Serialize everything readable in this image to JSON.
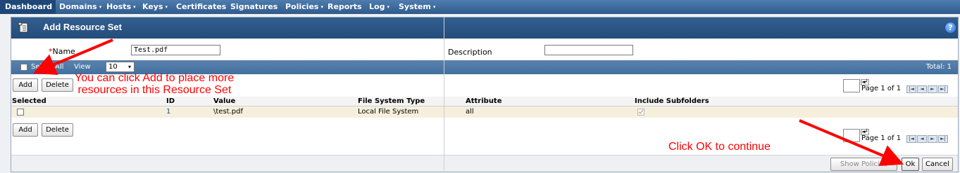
{
  "nav": {
    "items": [
      {
        "label": "Dashboard",
        "has_menu": false
      },
      {
        "label": "Domains",
        "has_menu": true
      },
      {
        "label": "Hosts",
        "has_menu": true
      },
      {
        "label": "Keys",
        "has_menu": true
      },
      {
        "label": "Certificates",
        "has_menu": false
      },
      {
        "label": "Signatures",
        "has_menu": false
      },
      {
        "label": "Policies",
        "has_menu": true
      },
      {
        "label": "Reports",
        "has_menu": false
      },
      {
        "label": "Log",
        "has_menu": true
      },
      {
        "label": "System",
        "has_menu": true
      }
    ],
    "caret": "▾"
  },
  "dialog": {
    "title": "Add Resource Set",
    "help_glyph": "?",
    "form": {
      "name_required_mark": "*",
      "name_label": "Name",
      "name_value": "Test.pdf",
      "description_label": "Description",
      "description_value": ""
    },
    "toolbar": {
      "select_all_label": "Select All",
      "view_label": "View",
      "view_value": "10",
      "total_label": "Total: 1"
    },
    "buttons": {
      "add": "Add",
      "delete": "Delete",
      "show_policies": "Show Policies",
      "ok": "Ok",
      "cancel": "Cancel"
    },
    "pager": {
      "text": "Page 1 of 1",
      "first": "|◄",
      "prev": "◄",
      "next": "►",
      "last": "►|"
    },
    "table": {
      "columns": [
        "Selected",
        "ID",
        "Value",
        "File System Type",
        "Attribute",
        "Include Subfolders"
      ],
      "rows": [
        {
          "selected": false,
          "id": "1",
          "value": "\\test.pdf",
          "fs_type": "Local File System",
          "attribute": "all",
          "include_subfolders": true
        }
      ]
    }
  },
  "annotations": {
    "add_hint": "You can click Add to place more\n resources in this Resource Set",
    "ok_hint": "Click OK to continue"
  },
  "colors": {
    "annotation": "#ff0000",
    "titlebar": "#2a5585",
    "row_highlight": "#f5efdc"
  }
}
